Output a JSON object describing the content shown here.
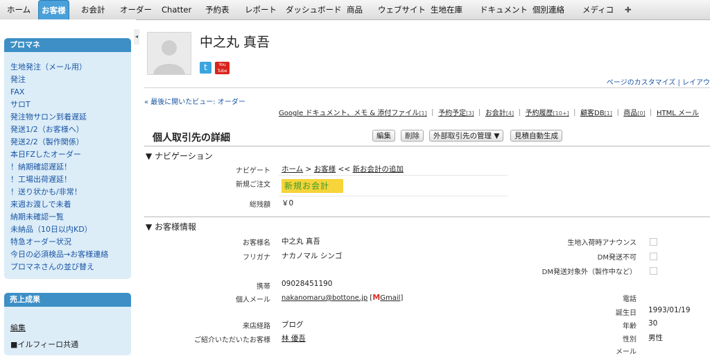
{
  "nav": {
    "tabs": [
      "ホーム",
      "お客様",
      "お会計",
      "オーダー",
      "Chatter",
      "予約表",
      "レポート",
      "ダッシュボード",
      "商品",
      "ウェブサイト",
      "生地在庫",
      "ドキュメント",
      "個別連絡",
      "メディコ"
    ],
    "plus": "✚"
  },
  "sidebar": {
    "promane": {
      "title": "プロマネ",
      "links": [
        "生地発注（メール用）",
        "発注",
        "FAX",
        "サロT",
        "発注物サロン到着遅延",
        "発送1/2（お客様へ）",
        "発送2/2（製作関係）",
        "本日FZしたオーダー",
        "！納期確認遅延！",
        "！工場出荷遅延！",
        "！送り状かも/非常！",
        "来週お渡しで未着",
        "納期未確認一覧",
        "未納品（10日以内KD）",
        "特急オーダー状況",
        "今日の必須検品→お客様連絡",
        "プロマネさんの並び替え"
      ]
    },
    "sales": {
      "title": "売上成果",
      "edit": "編集",
      "item": "■イルフィーロ共通"
    }
  },
  "header": {
    "name": "中之丸 真吾",
    "twitter": "t",
    "youtube": "You Tube",
    "customize": "ページのカスタマイズ | レイアウ",
    "last_view": "« 最後に開いたビュー: オーダー"
  },
  "related": [
    {
      "label": "Google ドキュメント、メモ & 添付ファイル",
      "count": "[1]"
    },
    {
      "label": "予約予定",
      "count": "[3]"
    },
    {
      "label": "お会計",
      "count": "[4]"
    },
    {
      "label": "予約履歴",
      "count": "[10+]"
    },
    {
      "label": "顧客DB",
      "count": "[1]"
    },
    {
      "label": "商品",
      "count": "[0]"
    },
    {
      "label": "HTML メール",
      "count": ""
    }
  ],
  "detail": {
    "title": "個人取引先の詳細",
    "buttons": [
      "編集",
      "削除",
      "外部取引先の管理 ▼",
      "見積自動生成"
    ]
  },
  "navigation": {
    "header": "▼ ナビゲーション",
    "rows": [
      {
        "label": "ナビゲート",
        "home": "ホーム",
        "sep1": ">",
        "customer": "お客様",
        "sep2": "<<",
        "add": "新お会計の追加"
      },
      {
        "label": "新規ご注文",
        "value": "新規お会計"
      },
      {
        "label": "総残額",
        "value": "￥0"
      }
    ]
  },
  "customer": {
    "header": "▼ お客様情報",
    "left": [
      {
        "label": "お客様名",
        "value": "中之丸 真吾"
      },
      {
        "label": "フリガナ",
        "value": "ナカノマル シンゴ"
      },
      {
        "label": "携帯",
        "value": "09028451190"
      },
      {
        "label": "個人メール",
        "value": "nakanomaru@bottone.jp",
        "gmail": "Gmail"
      },
      {
        "label": "来店経路",
        "value": "ブログ"
      },
      {
        "label": "ご紹介いただいたお客様",
        "value": "林 優吾"
      }
    ],
    "right": [
      {
        "label": "生地入荷時アナウンス"
      },
      {
        "label": "DM発送不可"
      },
      {
        "label": "DM発送対象外（製作中など）"
      },
      {
        "label": "電話",
        "value": ""
      },
      {
        "label": "誕生日",
        "value": "1993/01/19"
      },
      {
        "label": "年齢",
        "value": "30"
      },
      {
        "label": "性別",
        "value": "男性"
      },
      {
        "label": "メール",
        "value": ""
      }
    ]
  }
}
